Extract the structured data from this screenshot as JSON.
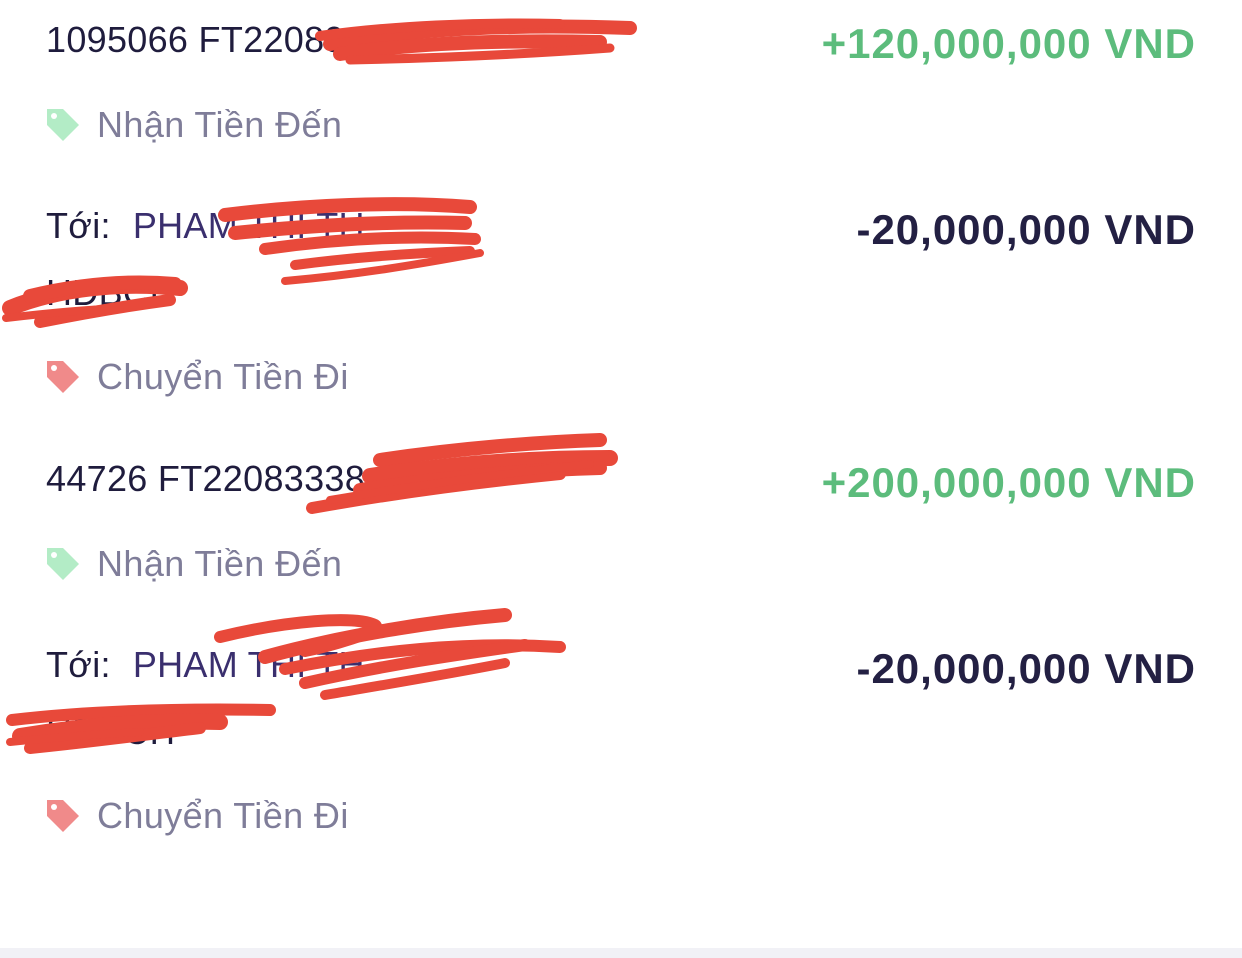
{
  "colors": {
    "incoming": "#5cbc7c",
    "outgoing": "#232043",
    "tag_in": "#b3ecc6",
    "tag_out": "#f08a8a",
    "tag_text": "#7f7d99",
    "redaction": "#e8493a"
  },
  "transactions": [
    {
      "line1": "1095066 FT22089450",
      "amount": "+120,000,000 VND",
      "category": "Nhận Tiền Đến",
      "category_icon": "tag-icon-green"
    },
    {
      "to_label": "Tới:",
      "to_name": "PHAM THI TH",
      "line2": "HDBCIT",
      "amount": "-20,000,000 VND",
      "category": "Chuyển Tiền Đi",
      "category_icon": "tag-icon-red"
    },
    {
      "line1": "44726 FT22083338",
      "amount": "+200,000,000 VND",
      "category": "Nhận Tiền Đến",
      "category_icon": "tag-icon-green"
    },
    {
      "to_label": "Tới:",
      "to_name": "PHAM THI TH",
      "line2": "HDBCIT",
      "amount": "-20,000,000 VND",
      "category": "Chuyển Tiền Đi",
      "category_icon": "tag-icon-red"
    }
  ]
}
